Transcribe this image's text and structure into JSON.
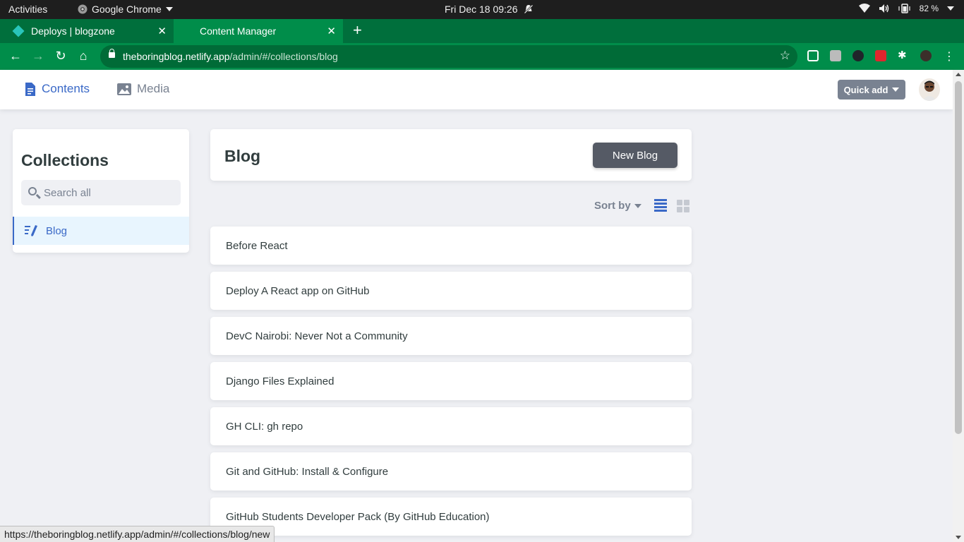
{
  "os_topbar": {
    "activities": "Activities",
    "app_name": "Google Chrome",
    "clock": "Fri Dec 18  09:26",
    "battery": "82 %"
  },
  "browser": {
    "tabs": [
      {
        "title": "Deploys | blogzone",
        "active": false
      },
      {
        "title": "Content Manager",
        "active": true
      }
    ],
    "url_host": "theboringblog.netlify.app",
    "url_path": "/admin/#/collections/blog",
    "status_link": "https://theboringblog.netlify.app/admin/#/collections/blog/new"
  },
  "cms_header": {
    "contents": "Contents",
    "media": "Media",
    "quick_add": "Quick add"
  },
  "sidebar": {
    "title": "Collections",
    "search_placeholder": "Search all",
    "items": [
      {
        "label": "Blog"
      }
    ]
  },
  "main": {
    "title": "Blog",
    "new_button": "New Blog",
    "sort_by": "Sort by",
    "entries": [
      "Before React",
      "Deploy A React app on GitHub",
      "DevC Nairobi: Never Not a Community",
      "Django Files Explained",
      "GH CLI: gh repo",
      "Git and GitHub: Install & Configure",
      "GitHub Students Developer Pack (By GitHub Education)"
    ]
  },
  "colors": {
    "accent": "#3a69c7",
    "chrome_frame": "#006f3c",
    "chrome_toolbar": "#008d4a",
    "background": "#eff0f4"
  }
}
